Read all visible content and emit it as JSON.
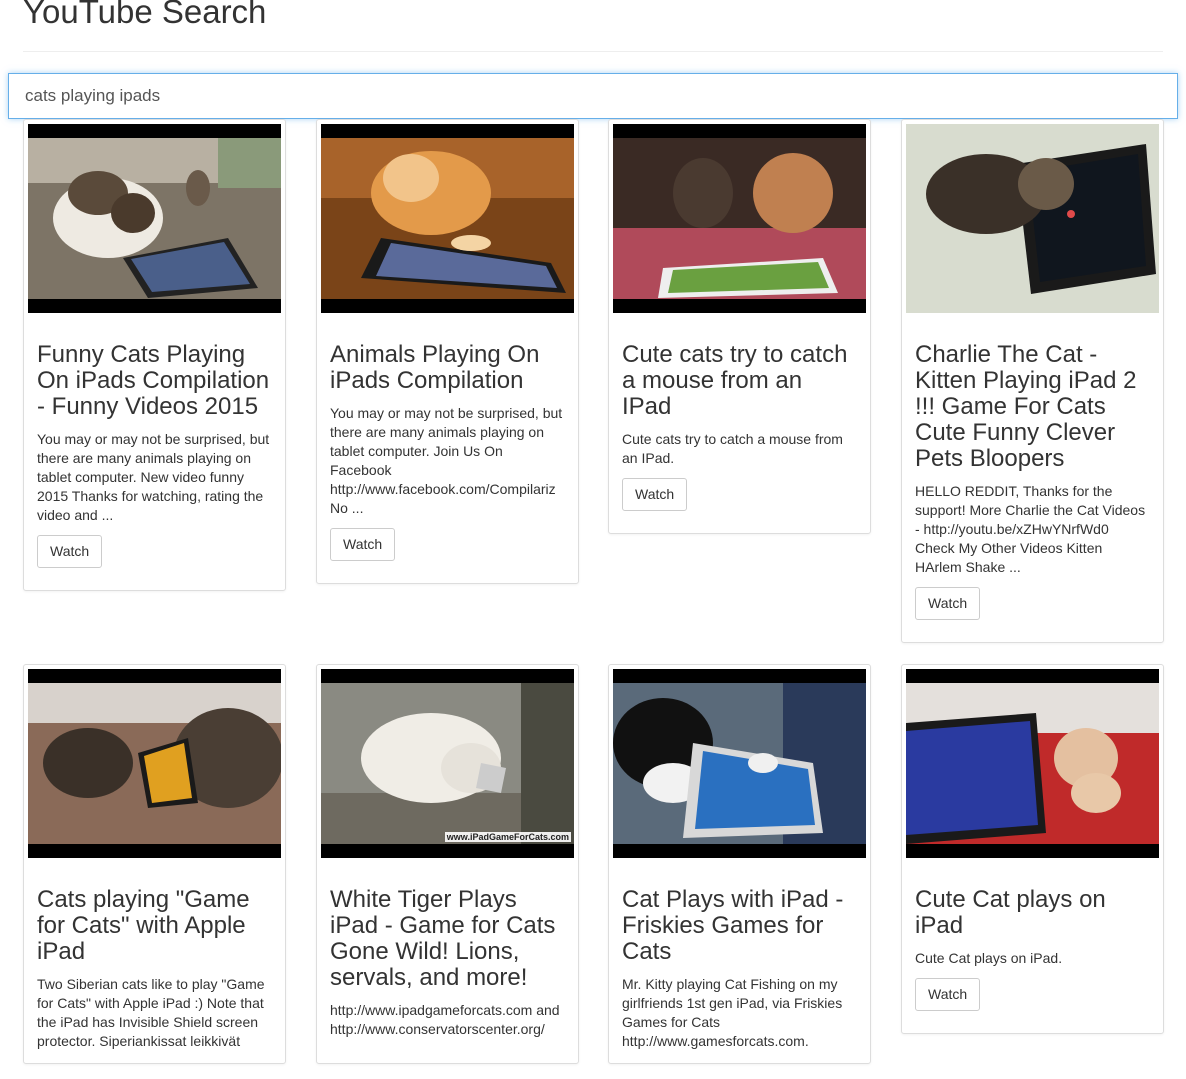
{
  "header": {
    "title": "YouTube Search"
  },
  "search": {
    "value": "cats playing ipads",
    "placeholder": ""
  },
  "button_label": "Watch",
  "results": [
    {
      "title": "Funny Cats Playing On iPads Compilation - Funny Videos 2015",
      "description": "You may or may not be surprised, but there are many animals playing on tablet computer. New video funny 2015 Thanks for watching, rating the video and ...",
      "thumbnail": "cat-with-ipad-on-floor"
    },
    {
      "title": "Animals Playing On iPads Compilation",
      "description": "You may or may not be surprised, but there are many animals playing on tablet computer. Join Us On Facebook http://www.facebook.com/CompilarizNo ...",
      "thumbnail": "orange-cat-pawing-ipad"
    },
    {
      "title": "Cute cats try to catch a mouse from an IPad",
      "description": "Cute cats try to catch a mouse from an IPad.",
      "thumbnail": "two-kittens-with-ipad"
    },
    {
      "title": "Charlie The Cat - Kitten Playing iPad 2 !!! Game For Cats Cute Funny Clever Pets Bloopers",
      "description": "HELLO REDDIT, Thanks for the support! More Charlie the Cat Videos - http://youtu.be/xZHwYNrfWd0 Check My Other Videos Kitten HArlem Shake ...",
      "thumbnail": "kitten-on-ipad-bed"
    },
    {
      "title": "Cats playing \"Game for Cats\" with Apple iPad",
      "description": "Two Siberian cats like to play \"Game for Cats\" with Apple iPad :) Note that the iPad has Invisible Shield screen protector. Siperiankissat leikkivät",
      "thumbnail": "siberian-cats-ipad"
    },
    {
      "title": "White Tiger Plays iPad - Game for Cats Gone Wild! Lions, servals, and more!",
      "description": "http://www.ipadgameforcats.com and http://www.conservatorscenter.org/",
      "thumbnail": "white-tiger-ipad",
      "watermark": "www.iPadGameForCats.com"
    },
    {
      "title": "Cat Plays with iPad - Friskies Games for Cats",
      "description": "Mr. Kitty playing Cat Fishing on my girlfriends 1st gen iPad, via Friskies Games for Cats http://www.gamesforcats.com.",
      "thumbnail": "black-white-cat-ipad"
    },
    {
      "title": "Cute Cat plays on iPad",
      "description": "Cute Cat plays on iPad.",
      "thumbnail": "kitten-red-sweater-ipad"
    }
  ]
}
